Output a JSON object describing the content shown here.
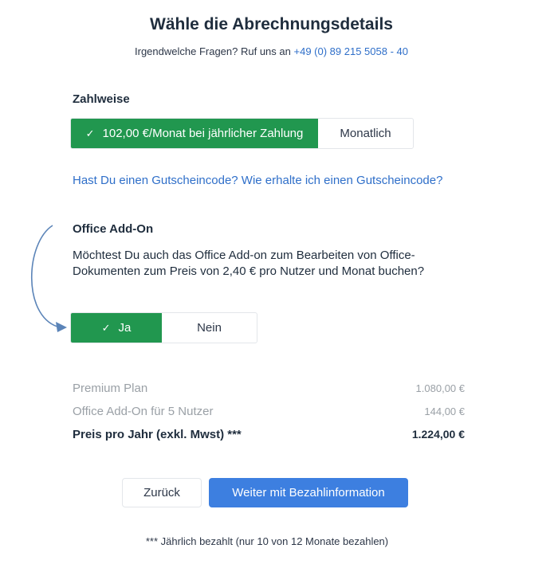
{
  "header": {
    "title": "Wähle die Abrechnungsdetails",
    "subtitle_prefix": "Irgendwelche Fragen? Ruf uns an",
    "phone": "+49 (0) 89 215 5058 - 40"
  },
  "payment": {
    "label": "Zahlweise",
    "options": [
      {
        "label": "102,00 €/Monat bei jährlicher Zahlung",
        "selected": true
      },
      {
        "label": "Monatlich",
        "selected": false
      }
    ]
  },
  "voucher": {
    "link_text": "Hast Du einen Gutscheincode? Wie erhalte ich einen Gutscheincode?"
  },
  "addon": {
    "label": "Office Add-On",
    "question": "Möchtest Du auch das Office Add-on zum Bearbeiten von Office-Dokumenten zum Preis von 2,40 € pro Nutzer und Monat buchen?",
    "options": [
      {
        "label": "Ja",
        "selected": true
      },
      {
        "label": "Nein",
        "selected": false
      }
    ]
  },
  "summary": {
    "rows": [
      {
        "label": "Premium Plan",
        "value": "1.080,00 €"
      },
      {
        "label": "Office Add-On für 5 Nutzer",
        "value": "144,00 €"
      }
    ],
    "total": {
      "label": "Preis pro Jahr (exkl. Mwst) ***",
      "value": "1.224,00 €"
    }
  },
  "actions": {
    "back_label": "Zurück",
    "next_label": "Weiter mit Bezahlinformation"
  },
  "footnote": "*** Jährlich bezahlt (nur 10 von 12 Monate bezahlen)",
  "colors": {
    "selected_green": "#21974f",
    "primary_blue": "#3d7fe0",
    "link_blue": "#2f6fc9",
    "annotation_arrow": "#5b84b8"
  },
  "icons": {
    "selected_check": "check-icon",
    "annotation": "curved-arrow-icon"
  }
}
